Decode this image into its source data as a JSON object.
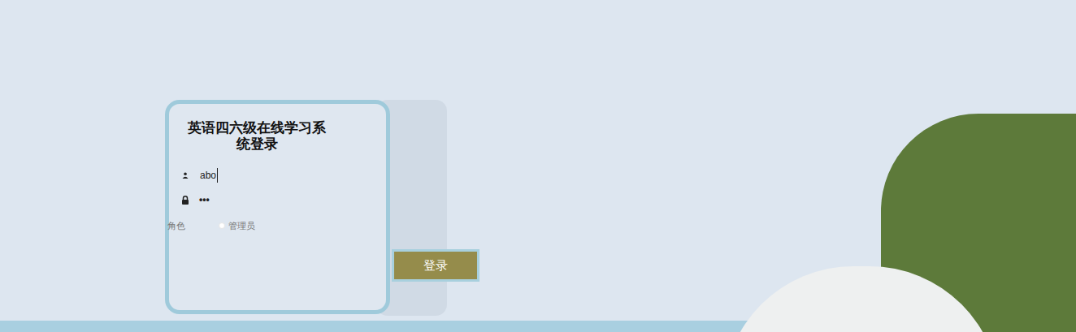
{
  "login": {
    "title": "英语四六级在线学习系统登录",
    "username": {
      "value": "abo"
    },
    "password": {
      "value": "•••"
    },
    "role": {
      "label": "角色",
      "options": [
        {
          "label": "管理员",
          "selected": false
        }
      ]
    },
    "button": "登录"
  }
}
